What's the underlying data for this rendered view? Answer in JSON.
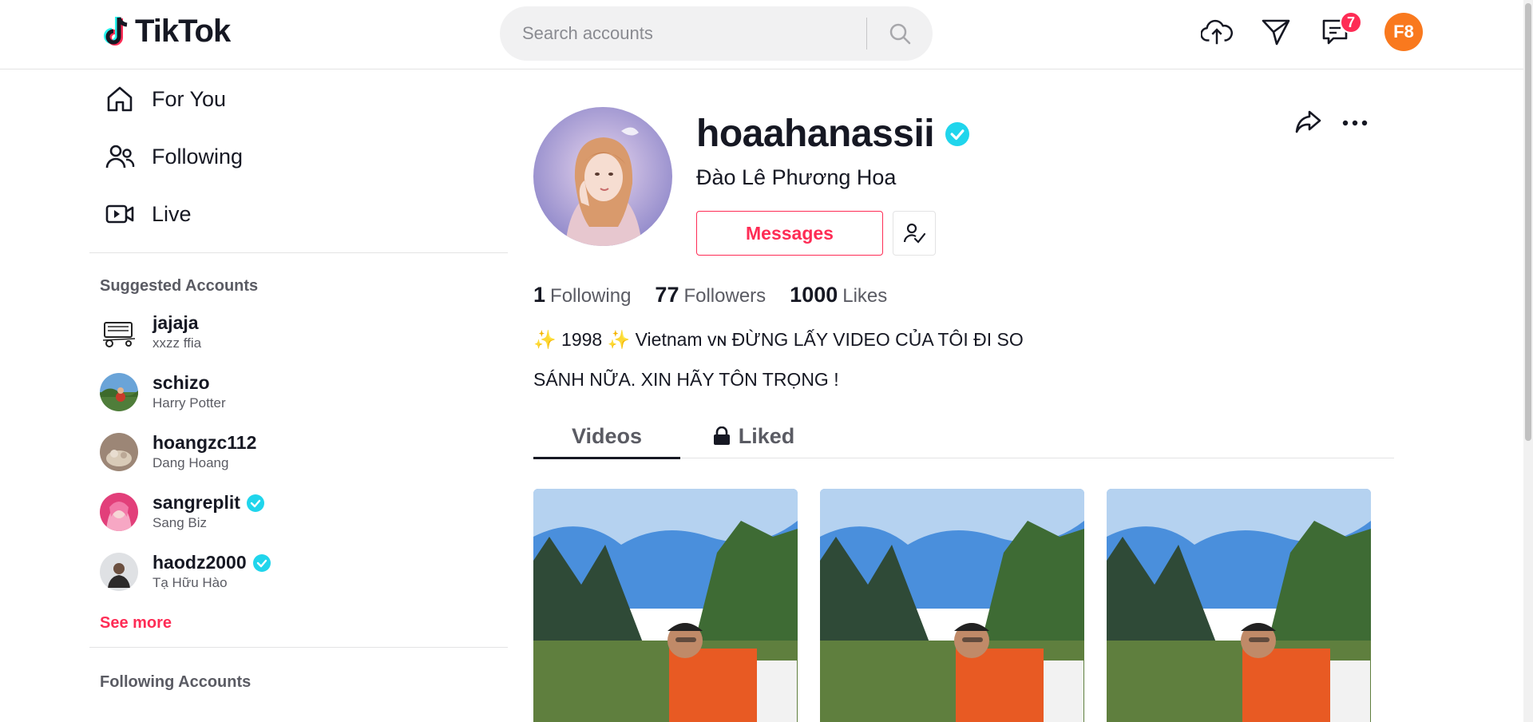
{
  "brand": {
    "name": "TikTok"
  },
  "search": {
    "placeholder": "Search accounts"
  },
  "header": {
    "messages_badge": "7",
    "user_initials": "F8"
  },
  "sidebar": {
    "nav": [
      {
        "label": "For You",
        "icon": "home-icon"
      },
      {
        "label": "Following",
        "icon": "users-icon"
      },
      {
        "label": "Live",
        "icon": "live-video-icon"
      }
    ],
    "suggested_title": "Suggested Accounts",
    "suggested": [
      {
        "username": "jajaja",
        "name": "xxzz ffia",
        "verified": false
      },
      {
        "username": "schizo",
        "name": "Harry Potter",
        "verified": false
      },
      {
        "username": "hoangzc112",
        "name": "Dang Hoang",
        "verified": false
      },
      {
        "username": "sangreplit",
        "name": "Sang Biz",
        "verified": true
      },
      {
        "username": "haodz2000",
        "name": "Tạ Hữu Hào",
        "verified": true
      }
    ],
    "see_more": "See more",
    "following_title": "Following Accounts"
  },
  "profile": {
    "username": "hoaahanassii",
    "display_name": "Đào Lê Phương Hoa",
    "messages_label": "Messages",
    "stats": {
      "following": "1",
      "following_label": "Following",
      "followers": "77",
      "followers_label": "Followers",
      "likes": "1000",
      "likes_label": "Likes"
    },
    "bio_line1": "✨ 1998 ✨ Vietnam ᴠɴ ĐỪNG LẤY VIDEO CỦA TÔI ĐI SO",
    "bio_line2": "SÁNH NỮA. XIN HÃY TÔN TRỌNG !"
  },
  "tabs": [
    {
      "label": "Videos"
    },
    {
      "label": "Liked"
    }
  ],
  "colors": {
    "accent": "#fe2c55",
    "verified": "#20d5ec",
    "avatar_me": "#f9791e"
  }
}
